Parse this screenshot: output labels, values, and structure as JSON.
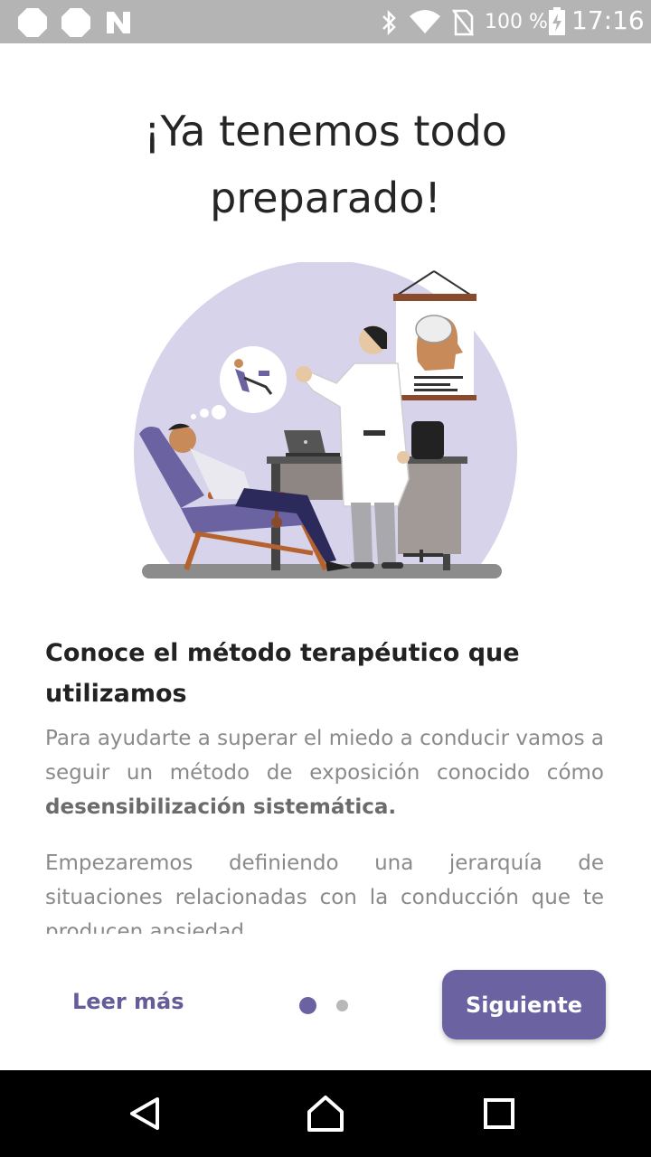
{
  "status_bar": {
    "left_icons": [
      "notification-dot-icon",
      "notification-dot-icon",
      "n-logo-icon"
    ],
    "right_icons": [
      "bluetooth-icon",
      "wifi-icon",
      "no-sim-icon",
      "battery-charging-icon"
    ],
    "battery": "100 %",
    "time": "17:16"
  },
  "title": {
    "line1": "¡Ya tenemos todo",
    "line2": "preparado!"
  },
  "illustration": {
    "description_icons": [
      "therapist-icon",
      "patient-recliner-icon",
      "thought-bubble-icon",
      "brain-poster-icon",
      "laptop-icon",
      "desk-icon"
    ],
    "colors": {
      "circle": "#d6d3ea",
      "accent": "#6b62a2",
      "wood": "#b6622e"
    }
  },
  "content": {
    "heading": "Conoce el método terapéutico que utilizamos",
    "paragraph1_start": "Para ayudarte a superar el miedo a conducir vamos a seguir un método de exposición conocido cómo ",
    "paragraph1_bold": "desensibilización sistemática.",
    "paragraph2": "Empezaremos definiendo una jerarquía de situaciones relacionadas con la conducción que te producen ansiedad..."
  },
  "controls": {
    "read_more": "Leer más",
    "next": "Siguiente",
    "pages_total": 2,
    "current_page": 1
  },
  "nav_bar": {
    "buttons": [
      "back-icon",
      "home-icon",
      "recents-icon"
    ]
  },
  "colors": {
    "accent": "#6b62a2",
    "status_bar": "#b4b4b4",
    "text_muted": "#8a8a8a"
  }
}
